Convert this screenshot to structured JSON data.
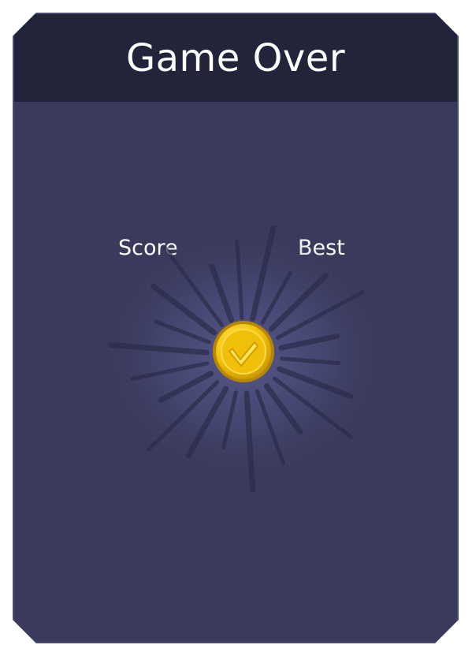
{
  "header": {
    "title": "Game Over"
  },
  "stats": {
    "score_label": "Score",
    "best_label": "Best"
  },
  "coin": {
    "icon": "coin-icon"
  },
  "colors": {
    "panel_bg": "#3a3a5c",
    "header_bg": "#22243a",
    "coin_gold": "#f2c40c"
  }
}
